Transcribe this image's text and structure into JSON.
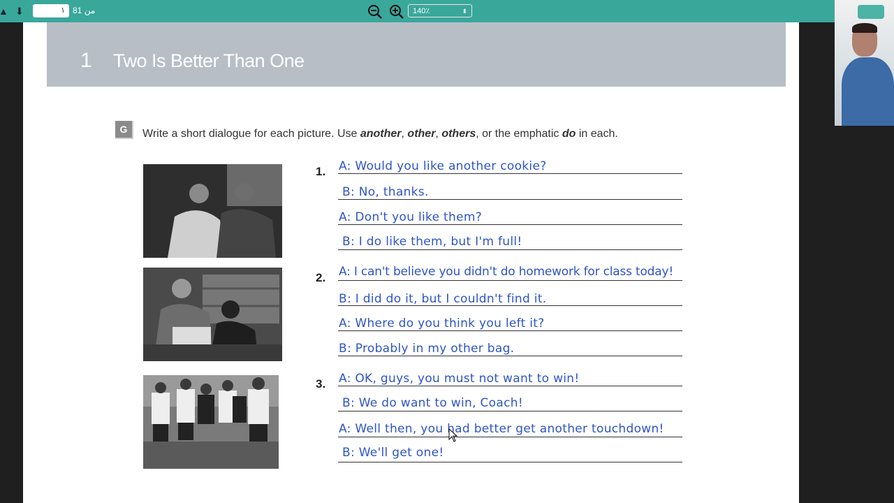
{
  "toolbar": {
    "page_current": "١",
    "page_total_label": "من 81",
    "zoom_value": "140٪"
  },
  "chapter": {
    "number": "1",
    "title": "Two Is Better Than One"
  },
  "exercise": {
    "letter": "G",
    "instruction_prefix": "Write a short dialogue for each picture. Use ",
    "w1": "another",
    "w2": "other",
    "w3": "others",
    "instruction_mid": ", or the emphatic ",
    "w4": "do",
    "instruction_suffix": " in each.",
    "sep": ", "
  },
  "dialogues": [
    {
      "number": "1.",
      "lines": [
        "A: Would you like another cookie?",
        "B: No, thanks.",
        "A: Don't you like them?",
        "B: I do like them, but I'm full!"
      ]
    },
    {
      "number": "2.",
      "lines": [
        "A: I can't believe you didn't do homework for class today!",
        "B: I did do it, but I couldn't find it.",
        "A: Where do you think you left it?",
        "B: Probably in my other bag."
      ]
    },
    {
      "number": "3.",
      "lines": [
        "A: OK, guys, you must not want to win!",
        "B: We do want to win, Coach!",
        "A: Well then, you had better get another touchdown!",
        "B: We'll get one!"
      ]
    }
  ]
}
